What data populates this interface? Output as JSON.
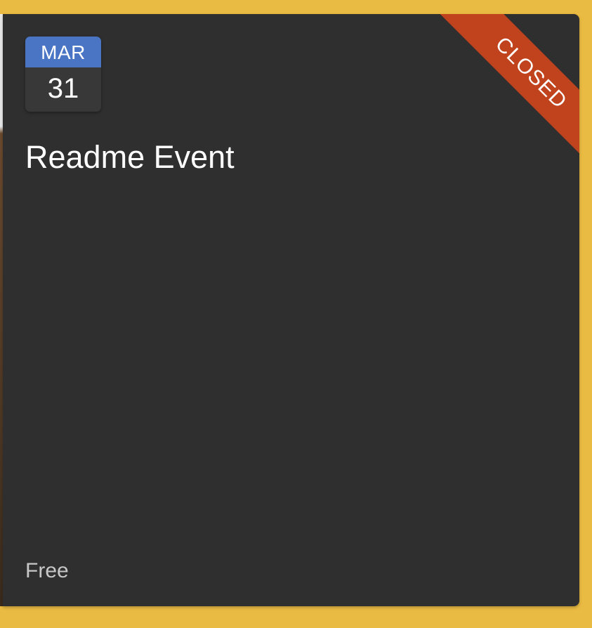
{
  "event": {
    "date": {
      "month": "MAR",
      "day": "31"
    },
    "title": "Readme Event",
    "price": "Free",
    "status": "CLOSED"
  },
  "colors": {
    "page_background": "#eabb42",
    "card_background": "#2f2f2f",
    "month_header": "#4a75c4",
    "status_ribbon": "#c1431d",
    "price_text": "#c7c7c7"
  }
}
